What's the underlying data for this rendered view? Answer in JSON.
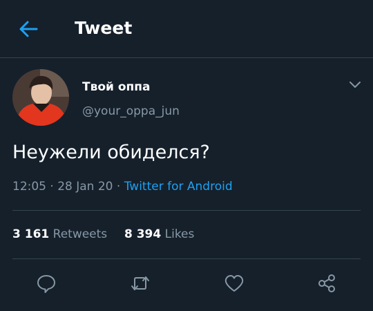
{
  "header": {
    "title": "Tweet",
    "back_icon": "arrow-left-icon"
  },
  "colors": {
    "background": "#15202b",
    "accent": "#1da1f2",
    "muted": "#8899a6",
    "divider": "#38444d"
  },
  "tweet": {
    "display_name": "Твой оппа",
    "handle": "@your_oppa_jun",
    "text": "Неужели обиделся?",
    "time": "12:05",
    "date": "28 Jan 20",
    "separator": " · ",
    "source": "Twitter for Android"
  },
  "stats": {
    "retweets_count": "3 161",
    "retweets_label": "Retweets",
    "likes_count": "8 394",
    "likes_label": "Likes"
  },
  "actions": [
    {
      "name": "reply-icon"
    },
    {
      "name": "retweet-icon"
    },
    {
      "name": "like-icon"
    },
    {
      "name": "share-icon"
    }
  ]
}
